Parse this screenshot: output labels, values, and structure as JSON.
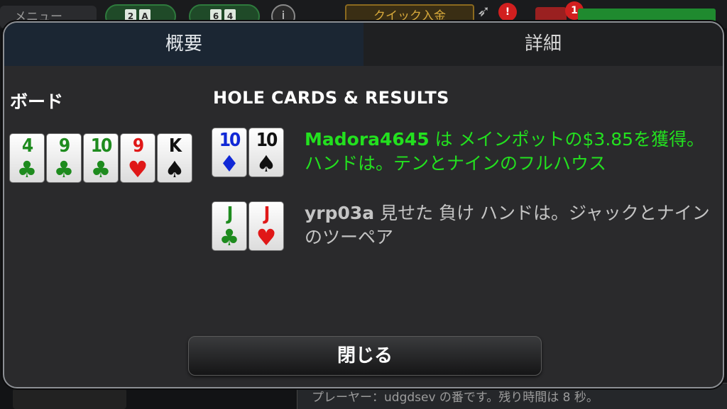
{
  "background": {
    "menu_label": "メニュー",
    "pill1_cards": [
      "2",
      "A"
    ],
    "pill2_cards": [
      "6",
      "4"
    ],
    "quick_button": "クイック入金",
    "darts_badge": "!",
    "chest_badge": "1",
    "chat_text": "プレーヤー：udgdsev の番です。残り時間は 8 秒。"
  },
  "tabs": [
    {
      "label": "概要",
      "active": true
    },
    {
      "label": "詳細",
      "active": false
    }
  ],
  "board": {
    "title": "ボード",
    "cards": [
      {
        "rank": "4",
        "suit": "♣"
      },
      {
        "rank": "9",
        "suit": "♣"
      },
      {
        "rank": "10",
        "suit": "♣"
      },
      {
        "rank": "9",
        "suit": "♥"
      },
      {
        "rank": "K",
        "suit": "♠"
      }
    ]
  },
  "results": {
    "title": "HOLE CARDS & RESULTS",
    "hands": [
      {
        "player": "Madora4645",
        "text": " は メインポットの$3.85を獲得。 ハンドは。テンとナインのフルハウス",
        "cards": [
          {
            "rank": "10",
            "suit": "♦"
          },
          {
            "rank": "10",
            "suit": "♠"
          }
        ]
      },
      {
        "player": "yrp03a",
        "text": " 見せた 負け ハンドは。ジャックとナインのツーペア",
        "cards": [
          {
            "rank": "J",
            "suit": "♣"
          },
          {
            "rank": "J",
            "suit": "♥"
          }
        ]
      }
    ]
  },
  "close_button": "閉じる",
  "colors": {
    "winner_text": "#23e01f",
    "loser_text": "#c4c4c4",
    "active_tab": "#1b2633",
    "club": "#1e8b1e",
    "heart": "#e01818",
    "diamond": "#1028d6",
    "spade": "#111111"
  }
}
